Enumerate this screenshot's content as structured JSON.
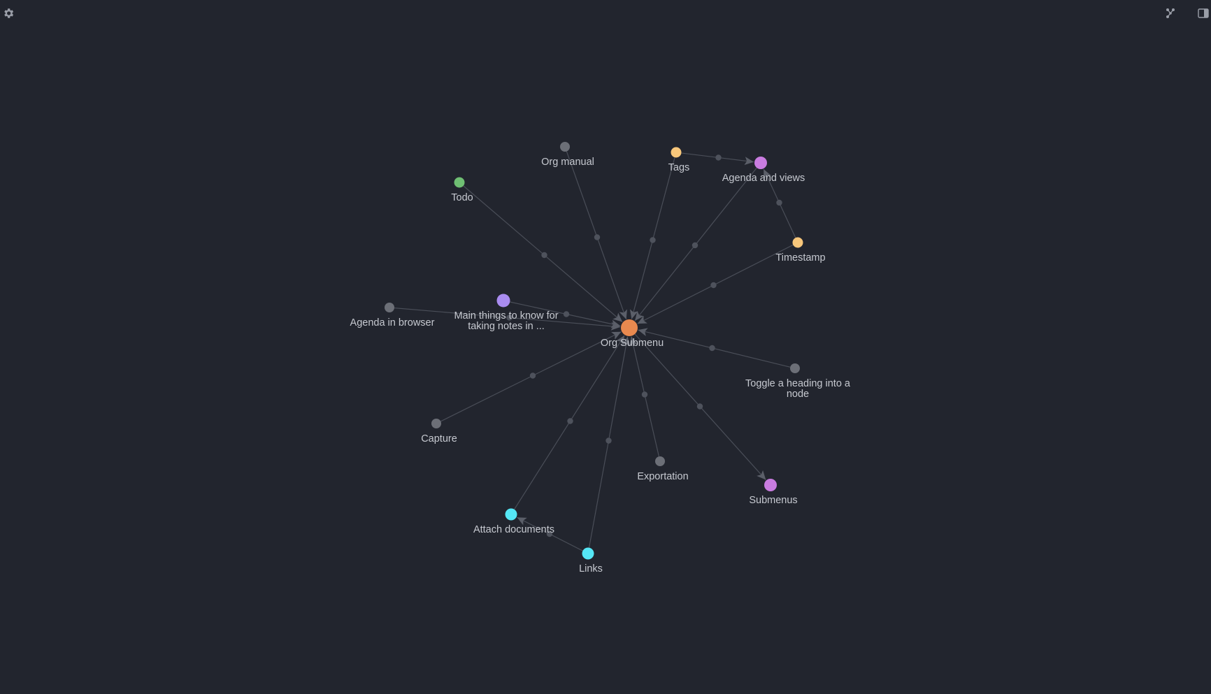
{
  "toolbar": {
    "left_icon": "gear-icon",
    "right_icons": [
      "graph-icon",
      "sidebar-toggle-icon"
    ]
  },
  "colors": {
    "background": "#22252e",
    "edge": "#4a4e58",
    "arrow": "#5b5f69",
    "label": "#c6c9d0",
    "icon": "#9a9ea8",
    "center": "#e8894f",
    "grey": "#6c6f77",
    "yellow": "#f8c77b",
    "purple": "#c97ce0",
    "violet": "#a98cf0",
    "green": "#6fbf73",
    "cyan": "#55e7f5"
  },
  "graph": {
    "center_id": "org-submenu",
    "nodes": [
      {
        "id": "org-submenu",
        "label": [
          "Org Submenu"
        ],
        "color": "center"
      },
      {
        "id": "org-manual",
        "label": [
          "Org manual"
        ],
        "color": "grey"
      },
      {
        "id": "tags",
        "label": [
          "Tags"
        ],
        "color": "yellow"
      },
      {
        "id": "agenda-and-views",
        "label": [
          "Agenda and views"
        ],
        "color": "purple"
      },
      {
        "id": "todo",
        "label": [
          "Todo"
        ],
        "color": "green"
      },
      {
        "id": "timestamp",
        "label": [
          "Timestamp"
        ],
        "color": "yellow"
      },
      {
        "id": "agenda-in-browser",
        "label": [
          "Agenda in browser"
        ],
        "color": "grey"
      },
      {
        "id": "main-things",
        "label": [
          "Main things to know for",
          "taking notes in ..."
        ],
        "color": "violet"
      },
      {
        "id": "toggle-heading",
        "label": [
          "Toggle a heading into a",
          "node"
        ],
        "color": "grey"
      },
      {
        "id": "capture",
        "label": [
          "Capture"
        ],
        "color": "grey"
      },
      {
        "id": "exportation",
        "label": [
          "Exportation"
        ],
        "color": "grey"
      },
      {
        "id": "submenus",
        "label": [
          "Submenus"
        ],
        "color": "purple"
      },
      {
        "id": "attach-documents",
        "label": [
          "Attach documents"
        ],
        "color": "cyan"
      },
      {
        "id": "links",
        "label": [
          "Links"
        ],
        "color": "cyan"
      }
    ],
    "edges": [
      {
        "from": "org-manual",
        "to": "org-submenu"
      },
      {
        "from": "tags",
        "to": "org-submenu"
      },
      {
        "from": "agenda-and-views",
        "to": "org-submenu"
      },
      {
        "from": "todo",
        "to": "org-submenu"
      },
      {
        "from": "timestamp",
        "to": "org-submenu"
      },
      {
        "from": "agenda-in-browser",
        "to": "org-submenu"
      },
      {
        "from": "main-things",
        "to": "org-submenu"
      },
      {
        "from": "toggle-heading",
        "to": "org-submenu"
      },
      {
        "from": "capture",
        "to": "org-submenu"
      },
      {
        "from": "exportation",
        "to": "org-submenu"
      },
      {
        "from": "org-submenu",
        "to": "submenus"
      },
      {
        "from": "attach-documents",
        "to": "org-submenu"
      },
      {
        "from": "links",
        "to": "org-submenu"
      },
      {
        "from": "tags",
        "to": "agenda-and-views"
      },
      {
        "from": "timestamp",
        "to": "agenda-and-views"
      },
      {
        "from": "links",
        "to": "attach-documents"
      }
    ]
  }
}
